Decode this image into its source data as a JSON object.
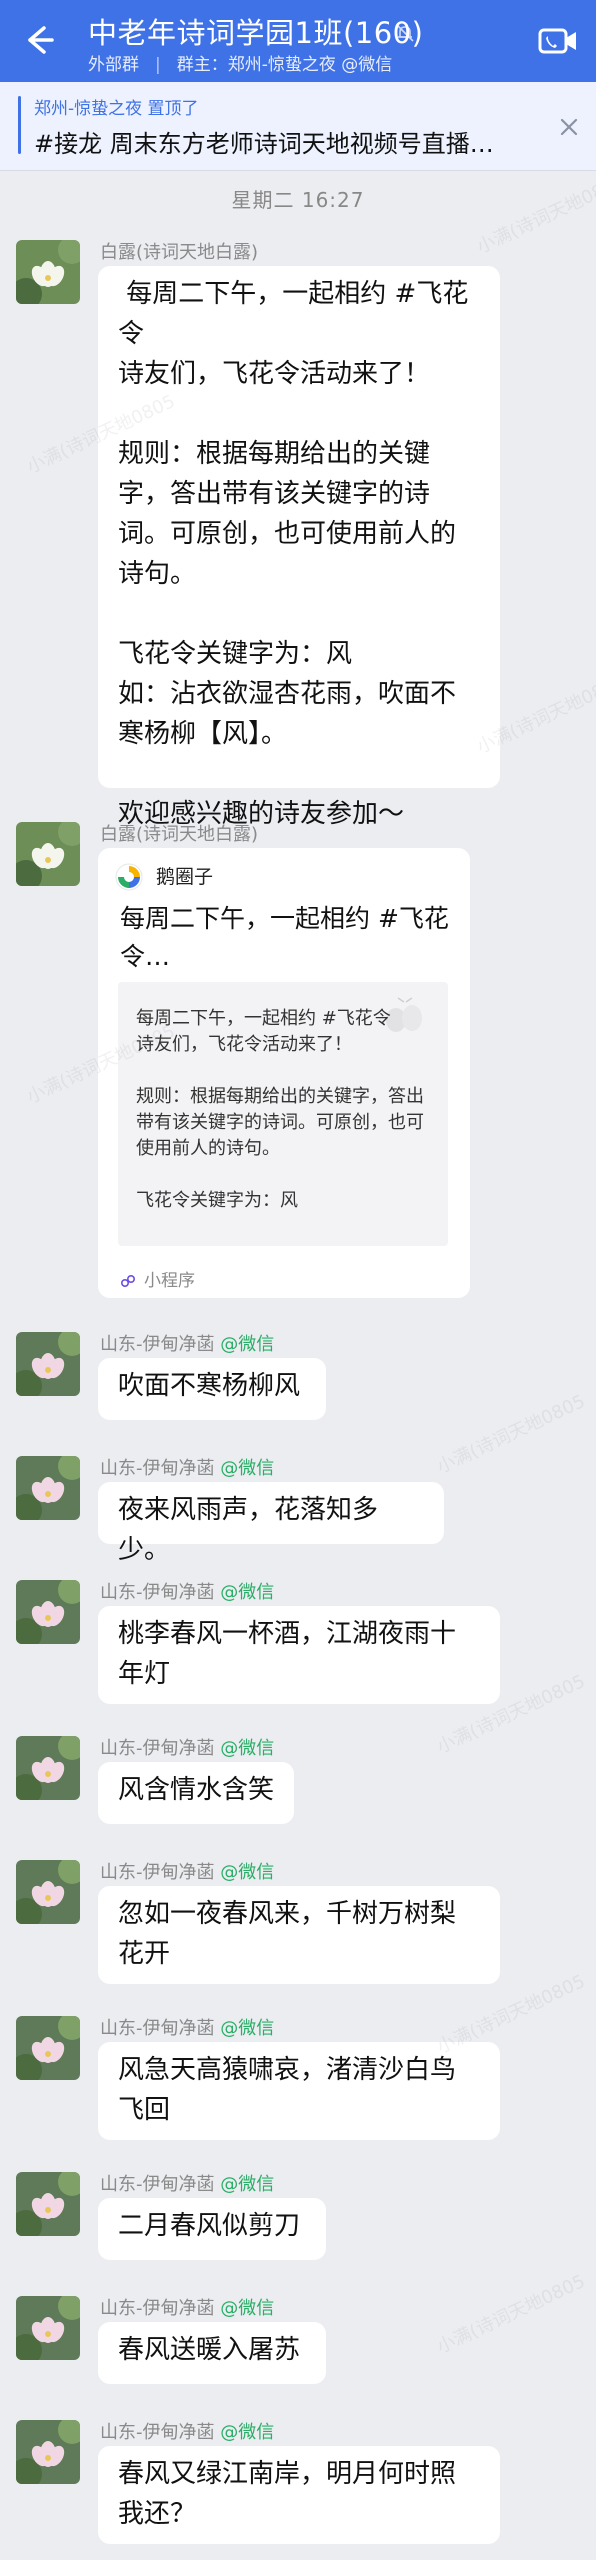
{
  "header": {
    "title": "中老年诗词学园1班(160)",
    "tag": "外部群",
    "owner": "群主：郑州-惊蛰之夜 @微信"
  },
  "pinned": {
    "top": "郑州-惊蛰之夜 置顶了",
    "text": "#接龙 周末东方老师诗词天地视频号直播…"
  },
  "time": "星期二  16:27",
  "messages": [
    {
      "sender": "白露(诗词天地白露)",
      "text": " 每周二下午，一起相约 #飞花令\n诗友们，飞花令活动来了！\n\n规则：根据每期给出的关键字，答出带有该关键字的诗词。可原创，也可使用前人的诗句。\n\n飞花令关键字为：风\n如：沾衣欲湿杏花雨，吹面不寒杨柳【风】。\n\n欢迎感兴趣的诗友参加～"
    },
    {
      "sender": "白露(诗词天地白露)",
      "card": {
        "source": "鹅圈子",
        "title": "每周二下午，一起相约 #飞花令…",
        "preview": "每周二下午，一起相约 #飞花令\n诗友们，飞花令活动来了！\n\n规则：根据每期给出的关键字，答出带有该关键字的诗词。可原创，也可使用前人的诗句。\n\n飞花令关键字为：风",
        "footer": "小程序"
      }
    },
    {
      "sender": "山东-伊甸净菡",
      "wechat": "@微信",
      "text": "吹面不寒杨柳风"
    },
    {
      "sender": "山东-伊甸净菡",
      "wechat": "@微信",
      "text": "夜来风雨声，花落知多少。"
    },
    {
      "sender": "山东-伊甸净菡",
      "wechat": "@微信",
      "text": "桃李春风一杯酒，江湖夜雨十年灯"
    },
    {
      "sender": "山东-伊甸净菡",
      "wechat": "@微信",
      "text": "风含情水含笑"
    },
    {
      "sender": "山东-伊甸净菡",
      "wechat": "@微信",
      "text": "忽如一夜春风来，千树万树梨花开"
    },
    {
      "sender": "山东-伊甸净菡",
      "wechat": "@微信",
      "text": "风急天高猿啸哀，渚清沙白鸟飞回"
    },
    {
      "sender": "山东-伊甸净菡",
      "wechat": "@微信",
      "text": "二月春风似剪刀"
    },
    {
      "sender": "山东-伊甸净菡",
      "wechat": "@微信",
      "text": "春风送暖入屠苏"
    },
    {
      "sender": "山东-伊甸净菡",
      "wechat": "@微信",
      "text": "春风又绿江南岸，明月何时照我还？"
    }
  ],
  "colors": {
    "header_blue": "#3f72e6",
    "background": "#ebedf0",
    "wechat_green": "#2aae67"
  },
  "watermark": "小满(诗词天地0805"
}
